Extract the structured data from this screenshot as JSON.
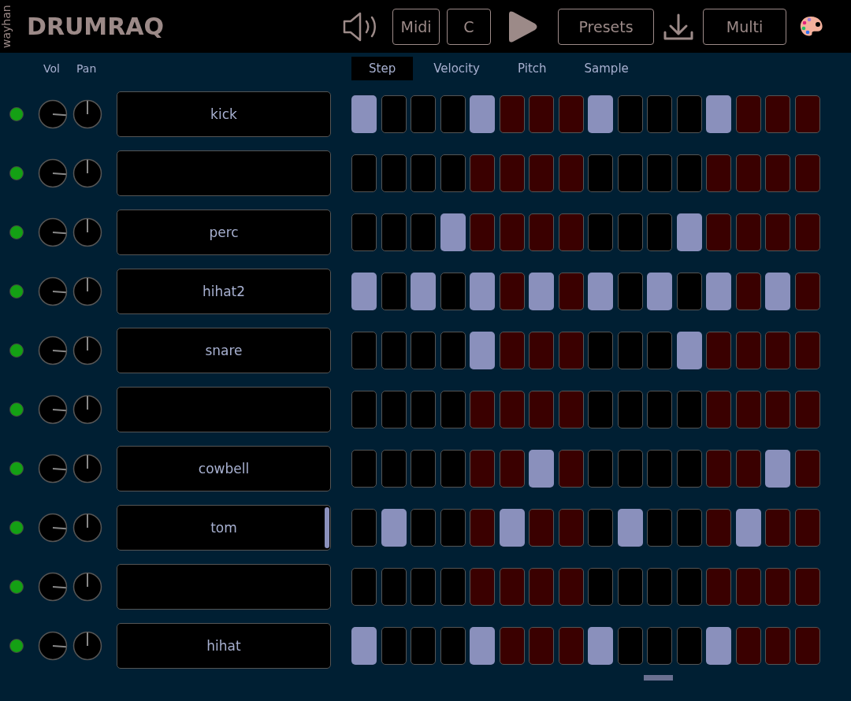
{
  "header": {
    "author": "wayhan",
    "title": "DRUMRAQ",
    "buttons": [
      "Midi",
      "C"
    ],
    "presets": "Presets",
    "mode": "Multi"
  },
  "columns": [
    "Vol",
    "Pan"
  ],
  "tabs": [
    {
      "label": "Step",
      "selected": true
    },
    {
      "label": "Velocity",
      "selected": false
    },
    {
      "label": "Pitch",
      "selected": false
    },
    {
      "label": "Sample",
      "selected": false
    }
  ],
  "tracks": [
    {
      "name": "kick",
      "active": true,
      "vol": {
        "level": 0.85
      },
      "pan": {
        "level": 0.5
      },
      "selected": false,
      "steps": [
        true,
        false,
        false,
        false,
        true,
        false,
        false,
        false,
        true,
        false,
        false,
        false,
        true,
        false,
        false,
        false
      ]
    },
    {
      "active": true,
      "vol": {
        "level": 0.85
      },
      "pan": {
        "level": 0.5
      },
      "selected": false,
      "steps": [
        false,
        false,
        false,
        false,
        false,
        false,
        false,
        false,
        false,
        false,
        false,
        false,
        false,
        false,
        false,
        false
      ]
    },
    {
      "name": "perc",
      "active": true,
      "vol": {
        "level": 0.85
      },
      "pan": {
        "level": 0.5
      },
      "selected": false,
      "steps": [
        false,
        false,
        false,
        true,
        false,
        false,
        false,
        false,
        false,
        false,
        false,
        true,
        false,
        false,
        false,
        false
      ]
    },
    {
      "name": "hihat2",
      "active": true,
      "vol": {
        "level": 0.85
      },
      "pan": {
        "level": 0.5
      },
      "selected": false,
      "steps": [
        true,
        false,
        true,
        false,
        true,
        false,
        true,
        false,
        true,
        false,
        true,
        false,
        true,
        false,
        true,
        false
      ]
    },
    {
      "name": "snare",
      "active": true,
      "vol": {
        "level": 0.85
      },
      "pan": {
        "level": 0.5
      },
      "selected": false,
      "steps": [
        false,
        false,
        false,
        false,
        true,
        false,
        false,
        false,
        false,
        false,
        false,
        true,
        false,
        false,
        false,
        false
      ]
    },
    {
      "active": true,
      "vol": {
        "level": 0.85
      },
      "pan": {
        "level": 0.5
      },
      "selected": false,
      "steps": [
        false,
        false,
        false,
        false,
        false,
        false,
        false,
        false,
        false,
        false,
        false,
        false,
        false,
        false,
        false,
        false
      ]
    },
    {
      "name": "cowbell",
      "active": true,
      "vol": {
        "level": 0.85
      },
      "pan": {
        "level": 0.5
      },
      "selected": false,
      "steps": [
        false,
        false,
        false,
        false,
        false,
        false,
        true,
        false,
        false,
        false,
        false,
        false,
        false,
        false,
        true,
        false
      ]
    },
    {
      "name": "tom",
      "active": true,
      "vol": {
        "level": 0.85
      },
      "pan": {
        "level": 0.5
      },
      "selected": true,
      "steps": [
        false,
        true,
        false,
        false,
        false,
        true,
        false,
        false,
        false,
        true,
        false,
        false,
        false,
        true,
        false,
        false
      ]
    },
    {
      "active": true,
      "vol": {
        "level": 0.85
      },
      "pan": {
        "level": 0.5
      },
      "selected": false,
      "steps": [
        false,
        false,
        false,
        false,
        false,
        false,
        false,
        false,
        false,
        false,
        false,
        false,
        false,
        false,
        false,
        false
      ]
    },
    {
      "name": "hihat",
      "active": true,
      "vol": {
        "level": 0.85
      },
      "pan": {
        "level": 0.5
      },
      "selected": false,
      "steps": [
        true,
        false,
        false,
        false,
        true,
        false,
        false,
        false,
        true,
        false,
        false,
        false,
        true,
        false,
        false,
        false
      ]
    }
  ]
}
